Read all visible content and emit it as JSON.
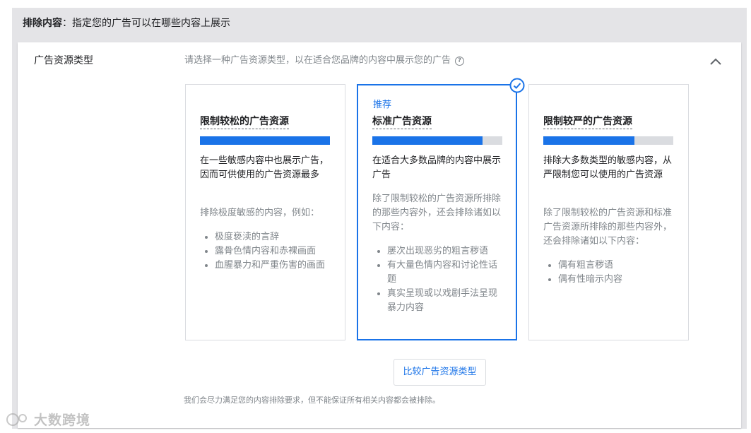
{
  "header": {
    "bold": "排除内容",
    "rest": "：指定您的广告可以在哪些内容上展示"
  },
  "panel": {
    "label": "广告资源类型",
    "description": "请选择一种广告资源类型，以在适合您品牌的内容中展示您的广告"
  },
  "cards": [
    {
      "title": "限制较松的广告资源",
      "level": 1.0,
      "summary": "在一些敏感内容中也展示广告，因而可供使用的广告资源最多",
      "intro": "排除极度敏感的内容，例如：",
      "items": [
        "极度亵渎的言辞",
        "露骨色情内容和赤裸画面",
        "血腥暴力和严重伤害的画面"
      ]
    },
    {
      "badge": "推荐",
      "title": "标准广告资源",
      "level": 0.85,
      "summary": "在适合大多数品牌的内容中展示广告",
      "intro": "除了限制较松的广告资源所排除的那些内容外，还会排除诸如以下内容：",
      "items": [
        "屡次出现恶劣的粗言秽语",
        "有大量色情内容和讨论性话题",
        "真实呈现或以戏剧手法呈现暴力内容"
      ]
    },
    {
      "title": "限制较严的广告资源",
      "level": 0.7,
      "summary": "排除大多数类型的敏感内容，从严限制您可以使用的广告资源",
      "intro": "除了限制较松的广告资源和标准广告资源所排除的那些内容外，还会排除诸如以下内容：",
      "items": [
        "偶有粗言秽语",
        "偶有性暗示内容"
      ]
    }
  ],
  "compare_button": "比较广告资源类型",
  "footnote": "我们会尽力满足您的内容排除要求，但不能保证所有相关内容都会被排除。",
  "watermark": "大数跨境",
  "colors": {
    "accent": "#1a73e8",
    "bar_track": "#dadce0",
    "muted": "#80868b"
  },
  "icons": {
    "help": "help-circle-icon",
    "collapse": "chevron-up-icon",
    "selected": "check-circle-icon"
  }
}
